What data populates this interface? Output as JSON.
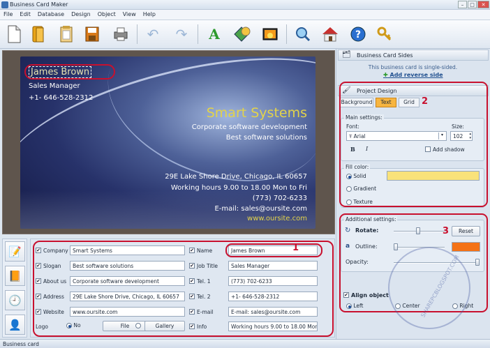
{
  "window": {
    "title": "Business Card Maker"
  },
  "menu": [
    "File",
    "Edit",
    "Database",
    "Design",
    "Object",
    "View",
    "Help"
  ],
  "toolbar": [
    "new-icon",
    "open-icon",
    "templates-icon",
    "save-icon",
    "print-icon",
    "undo-icon",
    "redo-icon",
    "add-text-icon",
    "add-shape-icon",
    "add-image-icon",
    "preview-icon",
    "home-icon",
    "help-icon",
    "key-icon"
  ],
  "card": {
    "name": "James Brown",
    "job_title": "Sales Manager",
    "phone": "+1- 646-528-2312",
    "company": "Smart Systems",
    "slogan": "Corporate software development",
    "about": "Best software solutions",
    "address": "29E Lake Shore Drive, Chicago, IL 60657",
    "hours": "Working hours 9.00 to 18.00 Mon to Fri",
    "tel2": "(773) 702-6233",
    "email": "E-mail: sales@oursite.com",
    "website": "www.oursite.com"
  },
  "fields": {
    "left": [
      {
        "label": "Company",
        "value": "Smart Systems"
      },
      {
        "label": "Slogan",
        "value": "Best software solutions"
      },
      {
        "label": "About us",
        "value": "Corporate software development"
      },
      {
        "label": "Address",
        "value": "29E Lake Shore Drive, Chicago, IL 60657"
      },
      {
        "label": "Website",
        "value": "www.oursite.com"
      }
    ],
    "right": [
      {
        "label": "Name",
        "value": "James Brown"
      },
      {
        "label": "Job Title",
        "value": "Sales Manager"
      },
      {
        "label": "Tel. 1",
        "value": "(773) 702-6233"
      },
      {
        "label": "Tel. 2",
        "value": "+1- 646-528-2312"
      },
      {
        "label": "E-mail",
        "value": "E-mail: sales@oursite.com"
      },
      {
        "label": "Info",
        "value": "Working hours 9.00 to 18.00 Mon to Fri"
      }
    ],
    "logo_label": "Logo",
    "logo_no": "No",
    "logo_file": "File",
    "logo_gallery": "Gallery"
  },
  "sides": {
    "header": "Business Card Sides",
    "info": "This business card is single-sided.",
    "add_link": "Add reverse side"
  },
  "design": {
    "header": "Project Design",
    "tabs": [
      "Background",
      "Text",
      "Grid"
    ],
    "active_tab": "Text",
    "main_settings": "Main settings:",
    "font_label": "Font:",
    "font_value": "Arial",
    "size_label": "Size:",
    "size_value": "102",
    "bold": "B",
    "italic": "I",
    "add_shadow": "Add shadow",
    "fill_color": "Fill color:",
    "solid": "Solid",
    "gradient": "Gradient",
    "texture": "Texture",
    "solid_color": "#f9e27a"
  },
  "additional": {
    "header": "Additional settings:",
    "rotate": "Rotate:",
    "reset": "Reset",
    "outline": "Outline:",
    "outline_color": "#f47216",
    "opacity": "Opacity:",
    "align": "Align object",
    "left": "Left",
    "center": "Center",
    "right": "Right"
  },
  "annotations": [
    "1",
    "2",
    "3"
  ],
  "watermark": "SHAREPCBLOGSPOT.COM",
  "status": "Business card"
}
